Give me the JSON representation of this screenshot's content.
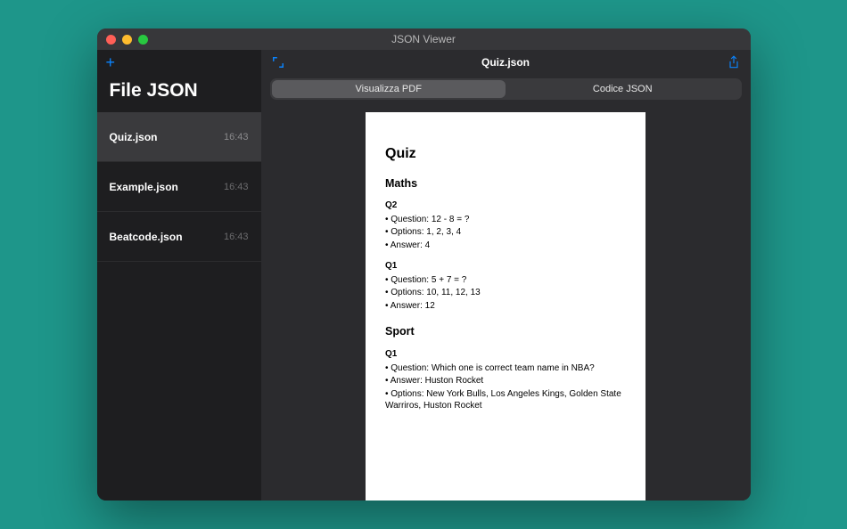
{
  "window": {
    "title": "JSON Viewer"
  },
  "sidebar": {
    "title": "File JSON",
    "add_label": "+",
    "files": [
      {
        "name": "Quiz.json",
        "time": "16:43",
        "selected": true
      },
      {
        "name": "Example.json",
        "time": "16:43",
        "selected": false
      },
      {
        "name": "Beatcode.json",
        "time": "16:43",
        "selected": false
      }
    ]
  },
  "main": {
    "title": "Quiz.json",
    "tabs": [
      {
        "label": "Visualizza PDF",
        "active": true
      },
      {
        "label": "Codice JSON",
        "active": false
      }
    ]
  },
  "document": {
    "title": "Quiz",
    "sections": [
      {
        "heading": "Maths",
        "items": [
          {
            "label": "Q2",
            "lines": [
              " • Question: 12 - 8 = ?",
              " • Options: 1, 2, 3, 4",
              " • Answer: 4"
            ]
          },
          {
            "label": "Q1",
            "lines": [
              " • Question: 5 + 7 = ?",
              " • Options: 10, 11, 12, 13",
              " • Answer: 12"
            ]
          }
        ]
      },
      {
        "heading": "Sport",
        "items": [
          {
            "label": "Q1",
            "lines": [
              " • Question: Which one is correct team name in NBA?",
              " • Answer: Huston Rocket",
              " • Options: New York Bulls, Los Angeles Kings, Golden State Warriros, Huston Rocket"
            ]
          }
        ]
      }
    ]
  }
}
